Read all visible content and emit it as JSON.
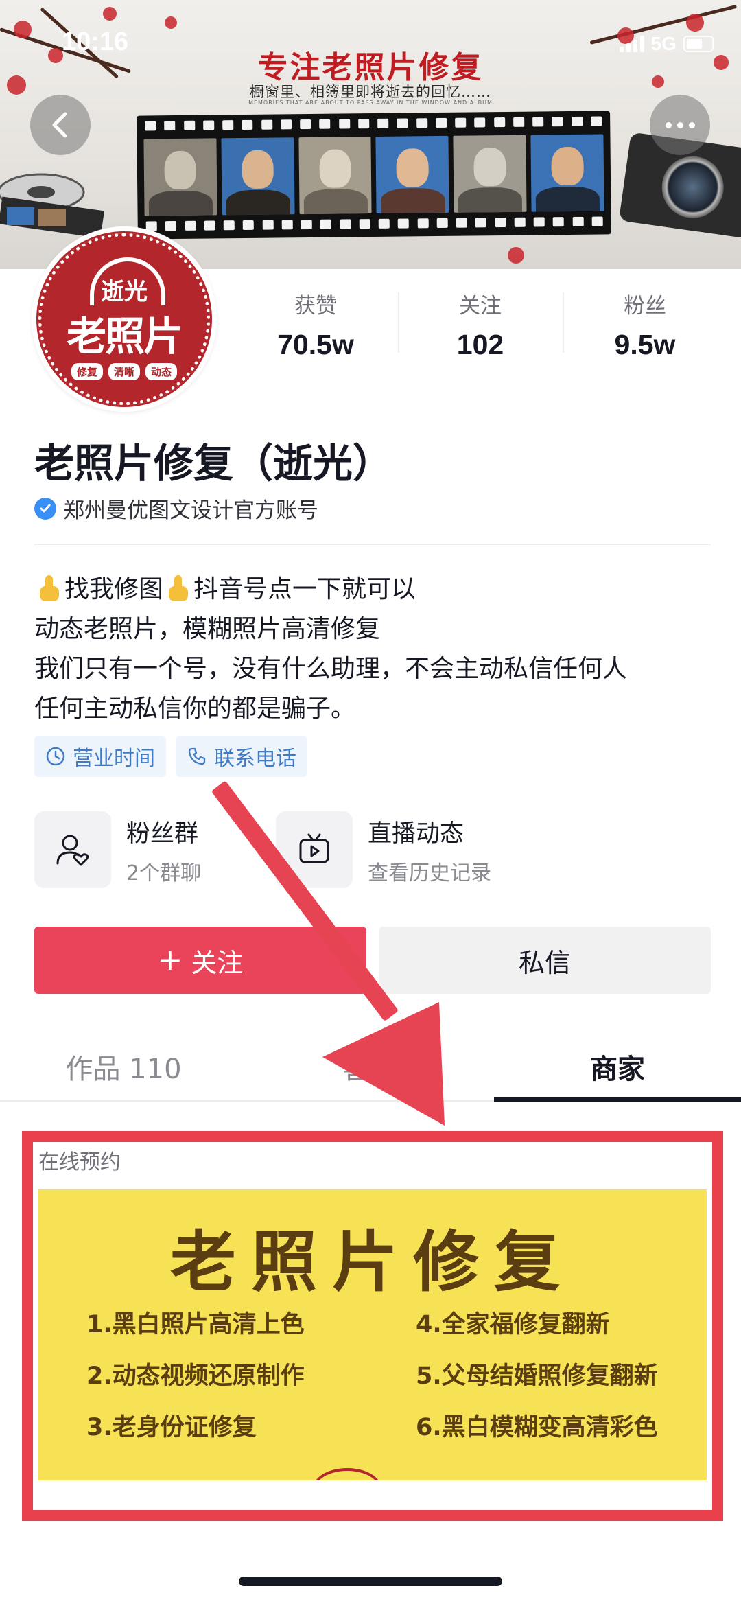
{
  "status_bar": {
    "time": "10:16",
    "network": "5G"
  },
  "banner": {
    "title": "专注老照片修复",
    "subtitle": "橱窗里、相簿里即将逝去的回忆……",
    "tiny_caption": "MEMORIES THAT ARE ABOUT TO PASS AWAY IN THE WINDOW AND ALBUM"
  },
  "avatar": {
    "top_text": "逝光",
    "main_text": "老照片",
    "tags": [
      "修复",
      "清晰",
      "动态"
    ]
  },
  "stats": [
    {
      "label": "获赞",
      "value": "70.5w"
    },
    {
      "label": "关注",
      "value": "102"
    },
    {
      "label": "粉丝",
      "value": "9.5w"
    }
  ],
  "profile": {
    "name": "老照片修复（逝光）",
    "verified_text": "郑州曼优图文设计官方账号",
    "bio_line1_a": "找我修图",
    "bio_line1_b": "抖音号点一下就可以",
    "bio_line2": "动态老照片，模糊照片高清修复",
    "bio_line3": "我们只有一个号，没有什么助理，不会主动私信任何人",
    "bio_line4": "任何主动私信你的都是骗子。"
  },
  "tags": {
    "hours": "营业时间",
    "phone": "联系电话"
  },
  "entries": {
    "fans_group": {
      "title": "粉丝群",
      "sub": "2个群聊"
    },
    "live": {
      "title": "直播动态",
      "sub": "查看历史记录"
    }
  },
  "buttons": {
    "follow": "关注",
    "follow_icon": "+",
    "message": "私信"
  },
  "tabs": [
    {
      "label": "作品 110"
    },
    {
      "label": "喜欢"
    },
    {
      "label": "商家"
    }
  ],
  "store": {
    "section_title": "在线预约",
    "poster_title": "老照片修复",
    "services": [
      "1.黑白照片高清上色",
      "4.全家福修复翻新",
      "2.动态视频还原制作",
      "5.父母结婚照修复翻新",
      "3.老身份证修复",
      "6.黑白模糊变高清彩色"
    ]
  },
  "colors": {
    "follow_red": "#e9445a",
    "annotation_red": "#e64452",
    "link_blue": "#3f7cc5",
    "poster_yellow": "#f7e155"
  },
  "icons": [
    "chevron-left-icon",
    "more-icon",
    "verified-icon",
    "clock-icon",
    "phone-icon",
    "group-icon",
    "tv-icon"
  ]
}
